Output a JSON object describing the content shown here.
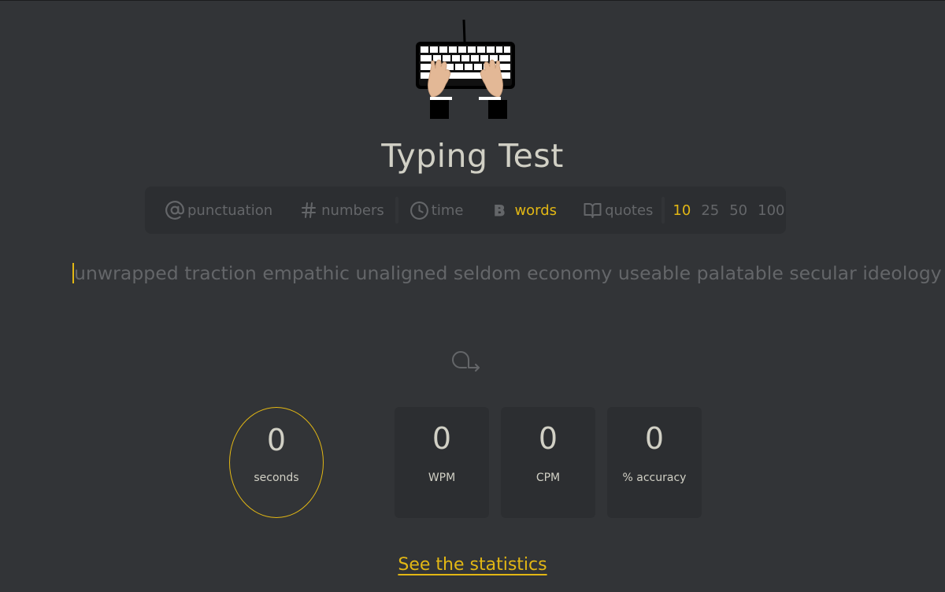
{
  "app": {
    "title": "Typing Test",
    "logo_icon": "keyboard-hands-logo"
  },
  "config": {
    "toggles": [
      {
        "label": "punctuation",
        "icon": "at-icon",
        "active": false
      },
      {
        "label": "numbers",
        "icon": "hash-icon",
        "active": false
      }
    ],
    "modes": [
      {
        "label": "time",
        "icon": "clock-icon",
        "active": false
      },
      {
        "label": "words",
        "icon": "bold-b-icon",
        "active": true
      },
      {
        "label": "quotes",
        "icon": "book-icon",
        "active": false
      }
    ],
    "counts": [
      "10",
      "25",
      "50",
      "100"
    ],
    "selected_count": "10"
  },
  "test": {
    "words": "unwrapped traction empathic unaligned seldom economy useable palatable secular ideology"
  },
  "controls": {
    "restart_icon": "restart-arrow-icon"
  },
  "stats": {
    "timer": {
      "value": "0",
      "label": "seconds"
    },
    "wpm": {
      "value": "0",
      "label": "WPM"
    },
    "cpm": {
      "value": "0",
      "label": "CPM"
    },
    "accuracy": {
      "value": "0",
      "label": "% accuracy"
    }
  },
  "footer": {
    "link_label": "See the statistics"
  },
  "colors": {
    "background": "#323437",
    "panel": "#2c2e31",
    "accent": "#e2b714",
    "text": "#d1d0c5",
    "muted": "#646669"
  }
}
